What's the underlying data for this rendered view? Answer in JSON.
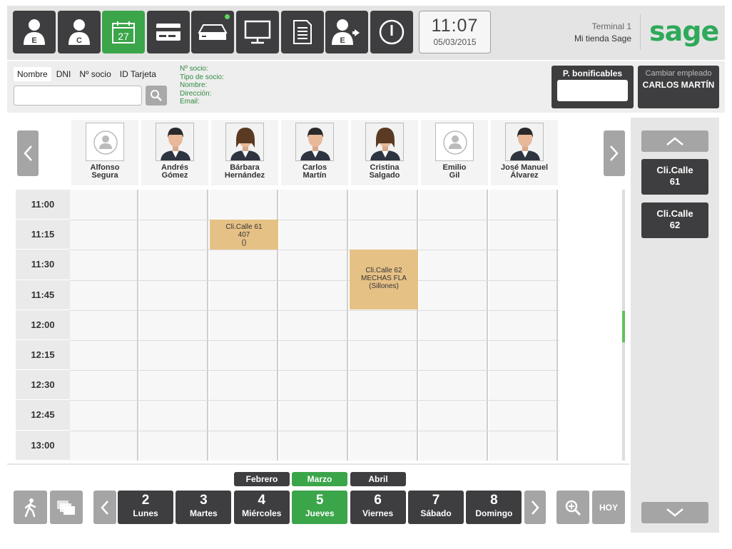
{
  "toolbar": {
    "buttons": [
      {
        "name": "employee-e",
        "letter": "E"
      },
      {
        "name": "client-c",
        "letter": "C"
      },
      {
        "name": "calendar",
        "day": "27"
      },
      {
        "name": "card"
      },
      {
        "name": "drawer"
      },
      {
        "name": "monitor"
      },
      {
        "name": "document"
      },
      {
        "name": "employee-exit",
        "letter": "E"
      },
      {
        "name": "power"
      }
    ],
    "time": "11:07",
    "date": "05/03/2015",
    "terminal": "Terminal 1",
    "store": "Mi tienda Sage",
    "logo": "sage"
  },
  "customer": {
    "tabs": [
      "Nombre",
      "DNI",
      "Nº socio",
      "ID Tarjeta"
    ],
    "selected_tab": "Nombre",
    "search_value": "",
    "info": [
      "Nº socio:",
      "Tipo de socio:",
      "Nombre:",
      "Dirección:",
      "Email:"
    ],
    "bonif_label": "P. bonificables",
    "bonif_value": "",
    "change_employee_label": "Cambiar empleado",
    "employee_name": "CARLOS MARTÍN"
  },
  "staff": [
    {
      "first": "Alfonso",
      "last": "Segura",
      "photo": "placeholder"
    },
    {
      "first": "Andrés",
      "last": "Gómez",
      "photo": "man"
    },
    {
      "first": "Bárbara",
      "last": "Hernández",
      "photo": "woman"
    },
    {
      "first": "Carlos",
      "last": "Martín",
      "photo": "man"
    },
    {
      "first": "Cristina",
      "last": "Salgado",
      "photo": "woman"
    },
    {
      "first": "Emilio",
      "last": "Gil",
      "photo": "placeholder"
    },
    {
      "first": "José Manuel",
      "last": "Álvarez",
      "photo": "man"
    }
  ],
  "times": [
    "11:00",
    "11:15",
    "11:30",
    "11:45",
    "12:00",
    "12:15",
    "12:30",
    "12:45",
    "13:00"
  ],
  "appointments": [
    {
      "lines": [
        "Cli.Calle 61",
        "407",
        "()"
      ],
      "staff": "Bárbara Hernández",
      "start": "11:15",
      "end": "11:30"
    },
    {
      "lines": [
        "Cli.Calle 62",
        "MECHAS FLA",
        "(Sillones)"
      ],
      "staff": "Cristina Salgado",
      "start": "11:30",
      "end": "12:00"
    }
  ],
  "queue": [
    {
      "line1": "Cli.Calle",
      "line2": "61"
    },
    {
      "line1": "Cli.Calle",
      "line2": "62"
    }
  ],
  "months": [
    "Febrero",
    "Marzo",
    "Abril"
  ],
  "selected_month": "Marzo",
  "days": [
    {
      "num": "2",
      "name": "Lunes"
    },
    {
      "num": "3",
      "name": "Martes"
    },
    {
      "num": "4",
      "name": "Miércoles"
    },
    {
      "num": "5",
      "name": "Jueves"
    },
    {
      "num": "6",
      "name": "Viernes"
    },
    {
      "num": "7",
      "name": "Sábado"
    },
    {
      "num": "8",
      "name": "Domingo"
    }
  ],
  "selected_day": "5",
  "today_label": "HOY",
  "colors": {
    "accent": "#3ba54a",
    "dark": "#3e3e40",
    "appointment": "#e6c186",
    "logo": "#2fa95a"
  }
}
